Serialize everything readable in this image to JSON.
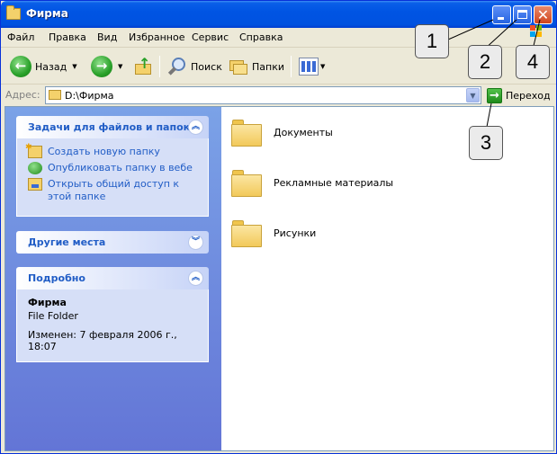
{
  "window": {
    "title": "Фирма"
  },
  "menu": [
    {
      "label": "Файл"
    },
    {
      "label": "Правка"
    },
    {
      "label": "Вид"
    },
    {
      "label": "Избранное"
    },
    {
      "label": "Сервис"
    },
    {
      "label": "Справка"
    }
  ],
  "toolbar": {
    "back_label": "Назад",
    "search_label": "Поиск",
    "folders_label": "Папки"
  },
  "address": {
    "label": "Адрес:",
    "value": "D:\\Фирма",
    "go_label": "Переход"
  },
  "tasks_panel": {
    "title": "Задачи для файлов и папок",
    "items": [
      {
        "label": "Создать новую папку",
        "icon": "new-folder-icon"
      },
      {
        "label": "Опубликовать папку в вебе",
        "icon": "publish-web-icon"
      },
      {
        "label": "Открыть общий доступ к этой папке",
        "icon": "share-folder-icon"
      }
    ]
  },
  "other_places": {
    "title": "Другие места"
  },
  "details": {
    "title": "Подробно",
    "name": "Фирма",
    "type": "File Folder",
    "modified": "Изменен: 7 февраля 2006 г., 18:07"
  },
  "folders": [
    {
      "name": "Документы"
    },
    {
      "name": "Рекламные материалы"
    },
    {
      "name": "Рисунки"
    }
  ],
  "callouts": [
    {
      "label": "1"
    },
    {
      "label": "2"
    },
    {
      "label": "3"
    },
    {
      "label": "4"
    }
  ],
  "colors": {
    "titlebar": "#0054e3",
    "task_link": "#215dc6",
    "panel_bg": "#d6dff7",
    "left_pane": "#6375d6"
  }
}
